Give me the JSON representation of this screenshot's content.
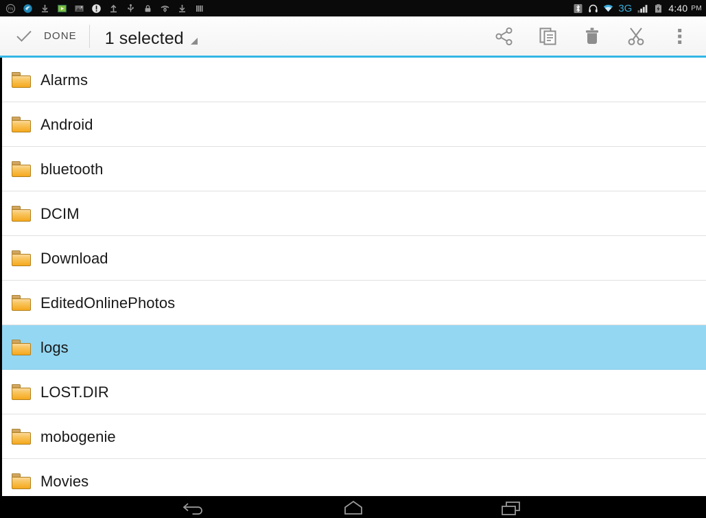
{
  "status_bar": {
    "left_icons": [
      {
        "name": "fn-notification-icon",
        "label": "FN"
      },
      {
        "name": "browser-notification-icon",
        "label": "browser"
      },
      {
        "name": "download-complete-icon",
        "label": "download"
      },
      {
        "name": "media-player-icon",
        "label": "player"
      },
      {
        "name": "image-notification-icon",
        "label": "image"
      },
      {
        "name": "alert-exclamation-icon",
        "label": "alert"
      },
      {
        "name": "upload-icon",
        "label": "upload"
      },
      {
        "name": "usb-icon",
        "label": "usb"
      },
      {
        "name": "lock-icon",
        "label": "lock"
      },
      {
        "name": "missed-call-icon",
        "label": "missed call"
      },
      {
        "name": "download-icon",
        "label": "download"
      },
      {
        "name": "equalizer-icon",
        "label": "equalizer"
      }
    ],
    "right_icons": [
      {
        "name": "bluetooth-icon",
        "label": "bluetooth"
      },
      {
        "name": "headset-icon",
        "label": "headset"
      },
      {
        "name": "wifi-icon",
        "label": "wifi"
      },
      {
        "name": "signal-bars-icon",
        "label": "signal"
      },
      {
        "name": "battery-icon",
        "label": "battery"
      }
    ],
    "network_type": "3G",
    "time": "4:40",
    "am_pm": "PM"
  },
  "action_bar": {
    "done_label": "DONE",
    "title": "1 selected",
    "actions": [
      {
        "name": "share-icon",
        "label": "Share"
      },
      {
        "name": "copy-icon",
        "label": "Copy"
      },
      {
        "name": "delete-icon",
        "label": "Delete"
      },
      {
        "name": "cut-icon",
        "label": "Cut"
      },
      {
        "name": "overflow-menu-icon",
        "label": "More options"
      }
    ]
  },
  "colors": {
    "accent": "#33b5e5",
    "selected_row": "#94d7f2",
    "folder_amber": "#f6a81d",
    "status_network": "#3aabdb",
    "list_background": "#ffffff",
    "divider": "#e0e0e0"
  },
  "file_list": {
    "items": [
      {
        "name": "Alarms",
        "type": "folder",
        "selected": false
      },
      {
        "name": "Android",
        "type": "folder",
        "selected": false
      },
      {
        "name": "bluetooth",
        "type": "folder",
        "selected": false
      },
      {
        "name": "DCIM",
        "type": "folder",
        "selected": false
      },
      {
        "name": "Download",
        "type": "folder",
        "selected": false
      },
      {
        "name": "EditedOnlinePhotos",
        "type": "folder",
        "selected": false
      },
      {
        "name": "logs",
        "type": "folder",
        "selected": true
      },
      {
        "name": "LOST.DIR",
        "type": "folder",
        "selected": false
      },
      {
        "name": "mobogenie",
        "type": "folder",
        "selected": false
      },
      {
        "name": "Movies",
        "type": "folder",
        "selected": false
      }
    ]
  },
  "nav_bar": {
    "buttons": [
      {
        "name": "back-icon",
        "label": "Back"
      },
      {
        "name": "home-icon",
        "label": "Home"
      },
      {
        "name": "recents-icon",
        "label": "Recent apps"
      }
    ]
  }
}
